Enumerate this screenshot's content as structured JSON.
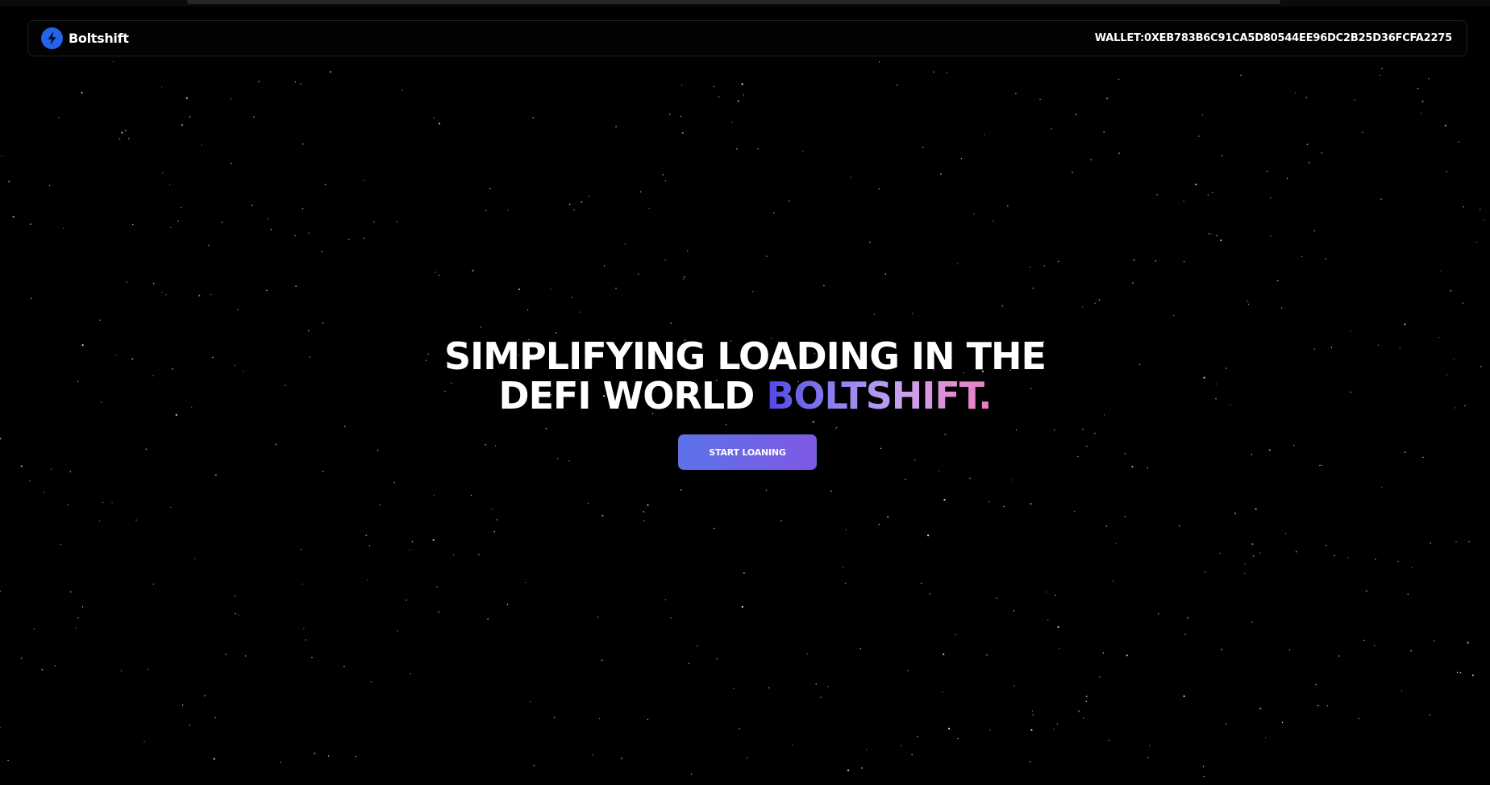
{
  "app": {
    "brand_name": "Boltshift",
    "logo_icon": "bolt-icon",
    "colors": {
      "background": "#000000",
      "logo_blue": "#2563eb",
      "accent_gradient": [
        "#4f46e5",
        "#ec7ec0"
      ],
      "button_gradient": [
        "#5b73e8",
        "#8058e6"
      ]
    }
  },
  "header": {
    "wallet_prefix": "WALLET:",
    "wallet_address": "0XEB783B6C91CA5D80544EE96DC2B25D36FCFA2275"
  },
  "hero": {
    "line1": "SIMPLIFYING LOADING IN THE",
    "line2_prefix": "DEFI WORLD ",
    "line2_accent": "BOLTSHIFT.",
    "cta_label": "START LOANING"
  }
}
